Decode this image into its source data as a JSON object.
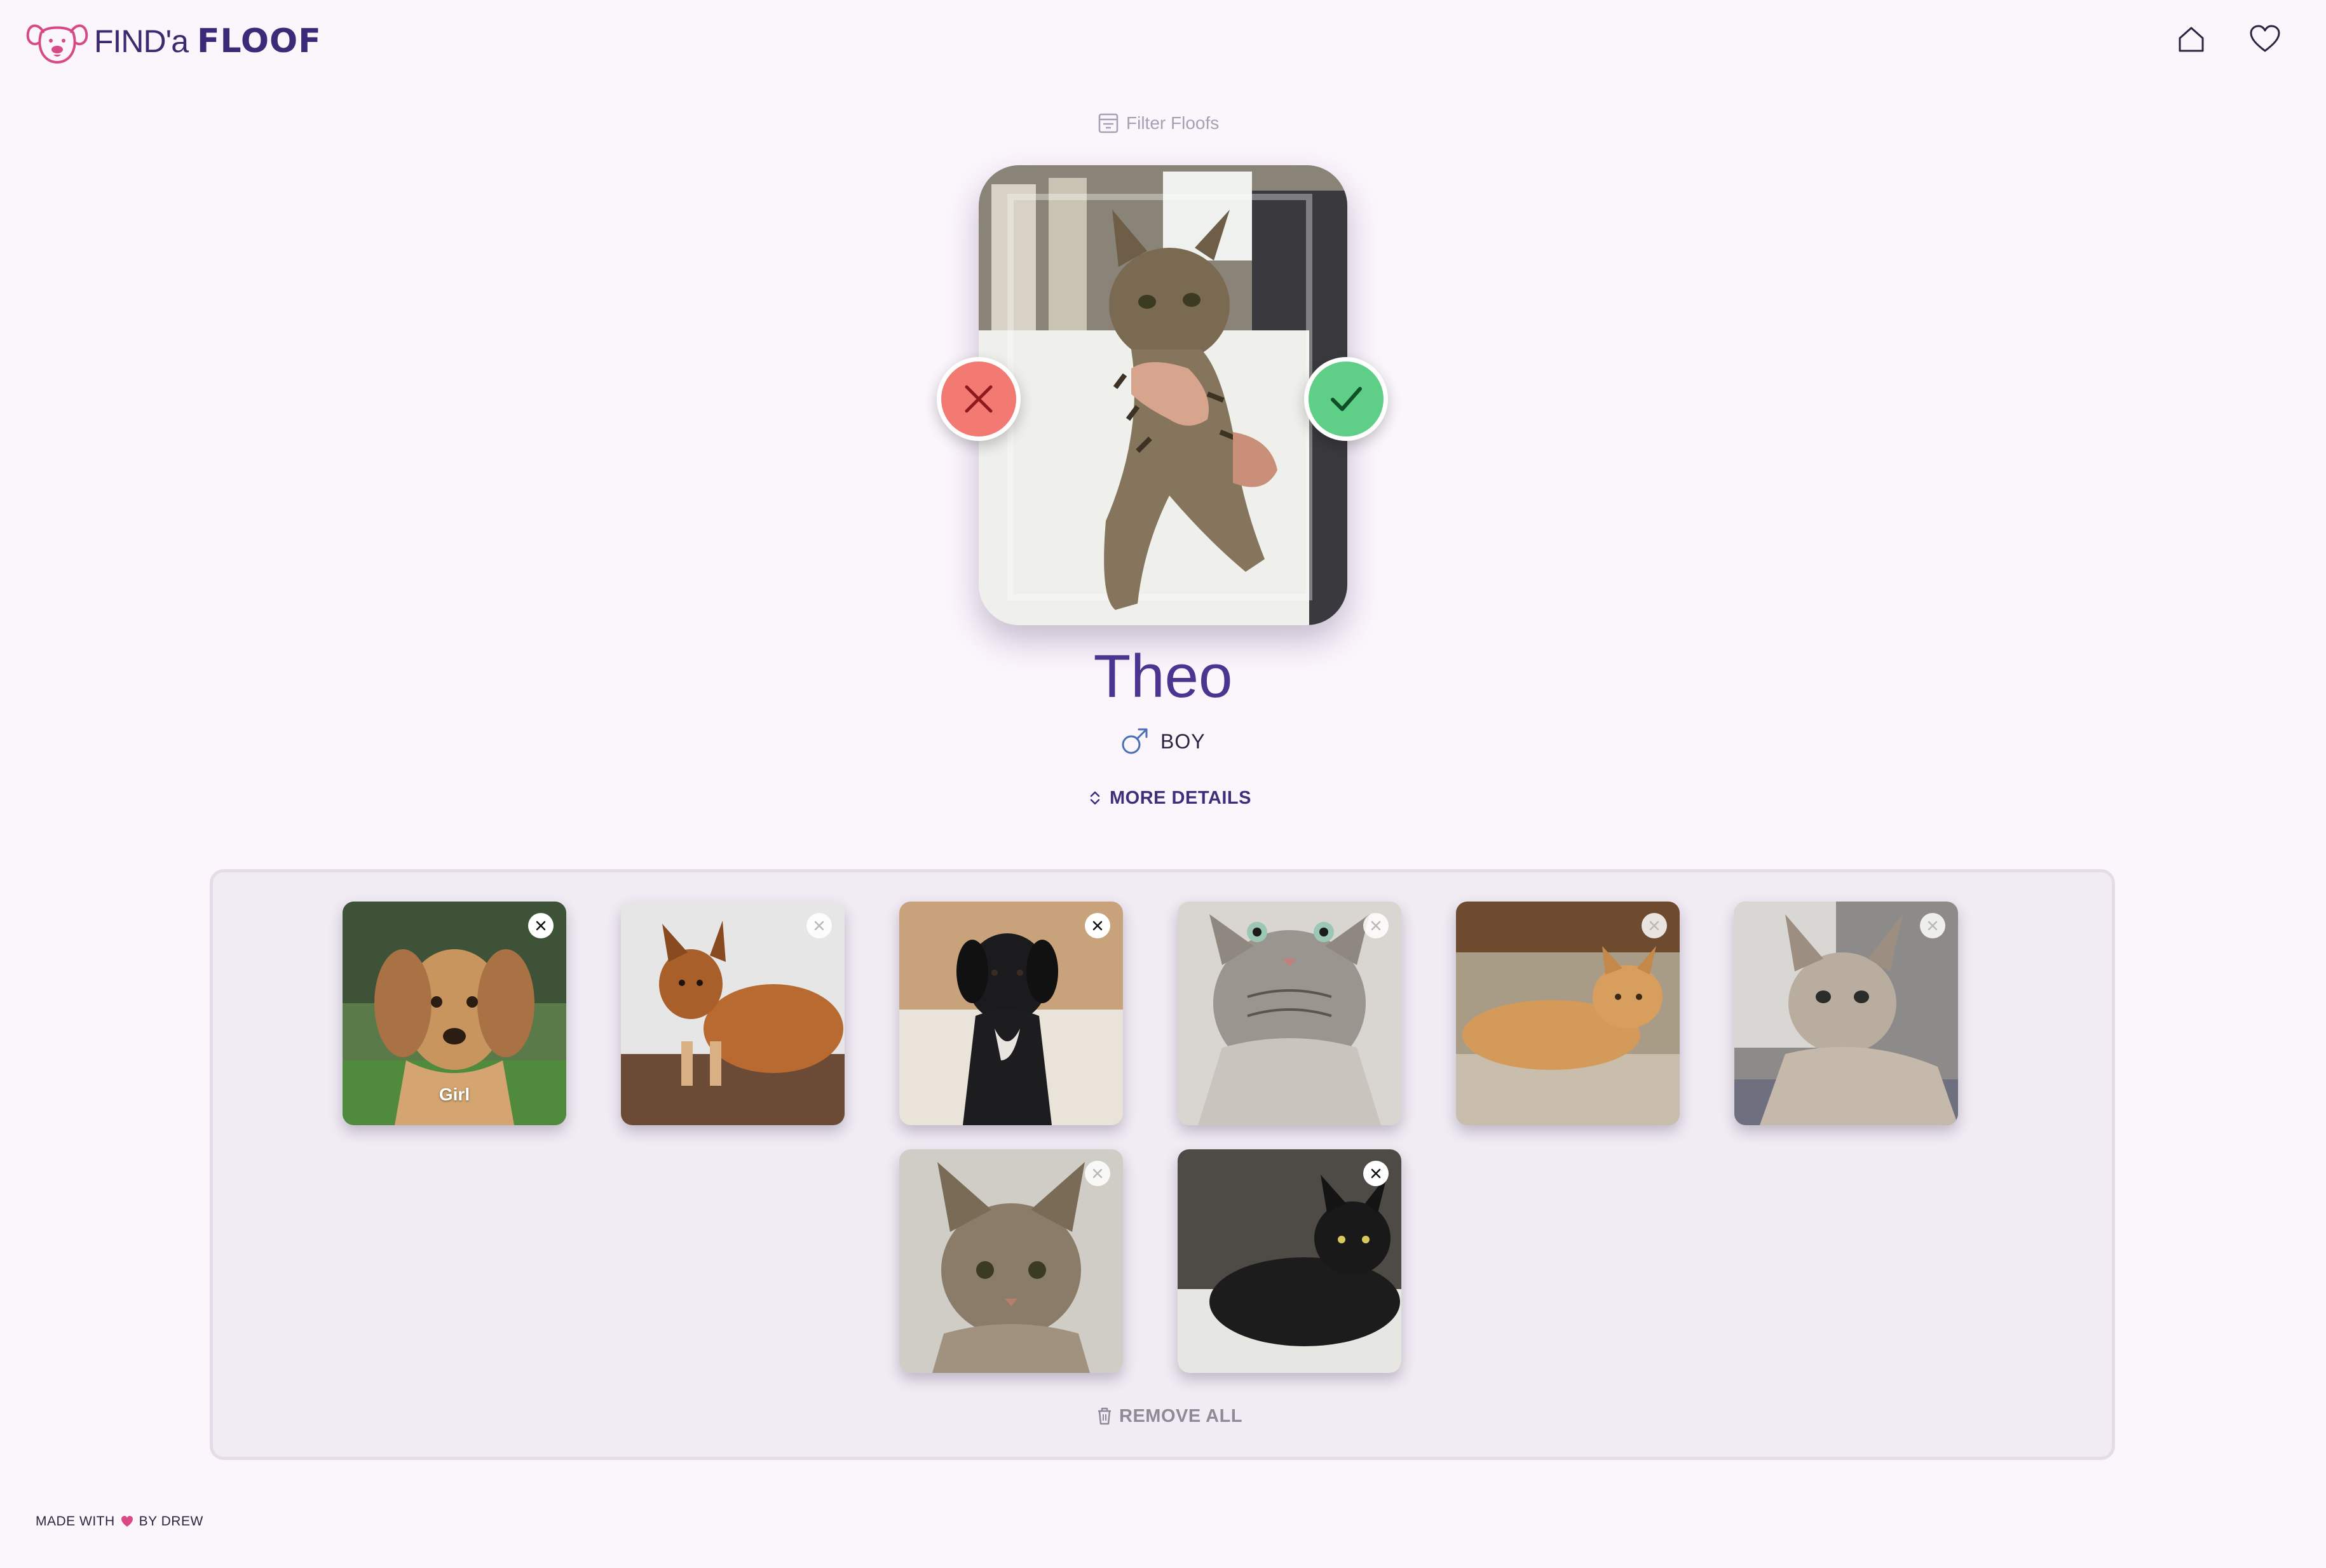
{
  "header": {
    "logo_find": "FIND'a",
    "logo_floof": "FLOOF",
    "home_icon": "home-icon",
    "favorites_icon": "heart-icon"
  },
  "filter": {
    "label": "Filter Floofs",
    "icon": "filter-icon"
  },
  "current_pet": {
    "name": "Theo",
    "gender_label": "BOY",
    "gender_icon": "male-icon",
    "more_details_label": "MORE DETAILS",
    "photo": "tabby-kitten-held"
  },
  "actions": {
    "reject_icon": "close-icon",
    "accept_icon": "check-icon"
  },
  "favorites": {
    "items": [
      {
        "photo": "golden-puppy",
        "badge": "Girl"
      },
      {
        "photo": "fluffy-brown-dog"
      },
      {
        "photo": "black-puppy"
      },
      {
        "photo": "grey-tabby-looking-up"
      },
      {
        "photo": "orange-fluffy-cat"
      },
      {
        "photo": "siamese-tabby-cat"
      },
      {
        "photo": "tabby-kitten-closeup"
      },
      {
        "photo": "black-cat-on-counter"
      }
    ],
    "remove_all_label": "REMOVE ALL"
  },
  "footer": {
    "made_with": "MADE WITH",
    "by": "BY DREW"
  },
  "colors": {
    "background": "#fbf5fc",
    "brand": "#3d2a6e",
    "accent_pink": "#d84a86",
    "reject": "#f27a73",
    "accept": "#5fcf88"
  }
}
